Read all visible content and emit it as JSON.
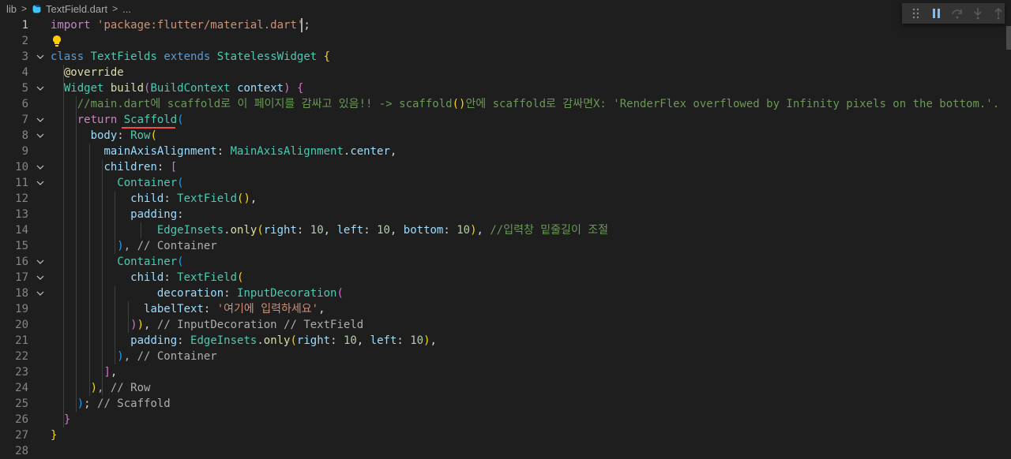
{
  "breadcrumb": {
    "folder": "lib",
    "file": "TextField.dart",
    "more": "..."
  },
  "lines": [
    {
      "n": "1"
    },
    {
      "n": "2"
    },
    {
      "n": "3"
    },
    {
      "n": "4"
    },
    {
      "n": "5"
    },
    {
      "n": "6"
    },
    {
      "n": "7"
    },
    {
      "n": "8"
    },
    {
      "n": "9"
    },
    {
      "n": "10"
    },
    {
      "n": "11"
    },
    {
      "n": "12"
    },
    {
      "n": "13"
    },
    {
      "n": "14"
    },
    {
      "n": "15"
    },
    {
      "n": "16"
    },
    {
      "n": "17"
    },
    {
      "n": "18"
    },
    {
      "n": "19"
    },
    {
      "n": "20"
    },
    {
      "n": "21"
    },
    {
      "n": "22"
    },
    {
      "n": "23"
    },
    {
      "n": "24"
    },
    {
      "n": "25"
    },
    {
      "n": "26"
    },
    {
      "n": "27"
    },
    {
      "n": "28"
    }
  ],
  "code": {
    "l1": {
      "kw": "import",
      "str": "'package:flutter/material.dart'",
      "end": ";"
    },
    "l3": {
      "kw": "class",
      "name": "TextFields",
      "ext": "extends",
      "base": "StatelessWidget",
      "end": " {"
    },
    "l4": {
      "ann": "@override"
    },
    "l5": {
      "type": "Widget",
      "fn": "build",
      "p1": "(",
      "ptype": "BuildContext",
      "pname": "context",
      "p2": ")",
      "end": " {"
    },
    "l6": {
      "cmt": "//main.dart에 scaffold로 이 페이지를 감싸고 있음!! -> scaffold",
      "b1": "()",
      "cmt2": "안에 scaffold로 감싸면X: 'RenderFlex overflowed by Infinity pixels on the bottom.'",
      "tail": "."
    },
    "l7": {
      "kw": "return",
      "cls": "Scaffold",
      "br": "("
    },
    "l8": {
      "prop": "body",
      "sep": ": ",
      "cls": "Row",
      "br": "("
    },
    "l9": {
      "prop": "mainAxisAlignment",
      "sep": ": ",
      "cls": "MainAxisAlignment",
      "dot": ".",
      "val": "center",
      "end": ","
    },
    "l10": {
      "prop": "children",
      "sep": ": ",
      "br": "["
    },
    "l11": {
      "cls": "Container",
      "br": "("
    },
    "l12": {
      "prop": "child",
      "sep": ": ",
      "cls": "TextField",
      "br": "()",
      "end": ","
    },
    "l13": {
      "prop": "padding",
      "sep": ":"
    },
    "l14": {
      "cls": "EdgeInsets",
      "dot": ".",
      "fn": "only",
      "b1": "(",
      "p1": "right",
      "n1": "10",
      "p2": "left",
      "n2": "10",
      "p3": "bottom",
      "n3": "10",
      "b2": ")",
      "sep": ", ",
      "cmt": "//입력창 밑줄길이 조절"
    },
    "l15": {
      "br": ")",
      "cmt": ", // Container"
    },
    "l16": {
      "cls": "Container",
      "br": "("
    },
    "l17": {
      "prop": "child",
      "sep": ": ",
      "cls": "TextField",
      "br": "("
    },
    "l18": {
      "prop": "decoration",
      "sep": ": ",
      "cls": "InputDecoration",
      "br": "("
    },
    "l19": {
      "prop": "labelText",
      "sep": ": ",
      "str": "'여기에 입력하세요'",
      "end": ","
    },
    "l20": {
      "br1": ")",
      "br2": ")",
      "end": ",",
      "cmt": " // InputDecoration // TextField"
    },
    "l21": {
      "prop": "padding",
      "sep": ": ",
      "cls": "EdgeInsets",
      "dot": ".",
      "fn": "only",
      "b1": "(",
      "p1": "right",
      "n1": "10",
      "p2": "left",
      "n2": "10",
      "b2": ")",
      "end": ","
    },
    "l22": {
      "br": ")",
      "cmt": ", // Container"
    },
    "l23": {
      "br": "]",
      "end": ","
    },
    "l24": {
      "br": ")",
      "cmt": ", // Row"
    },
    "l25": {
      "br": ")",
      "end": ";",
      "cmt": " // Scaffold"
    },
    "l26": {
      "br": "}"
    },
    "l27": {
      "br": "}"
    }
  }
}
